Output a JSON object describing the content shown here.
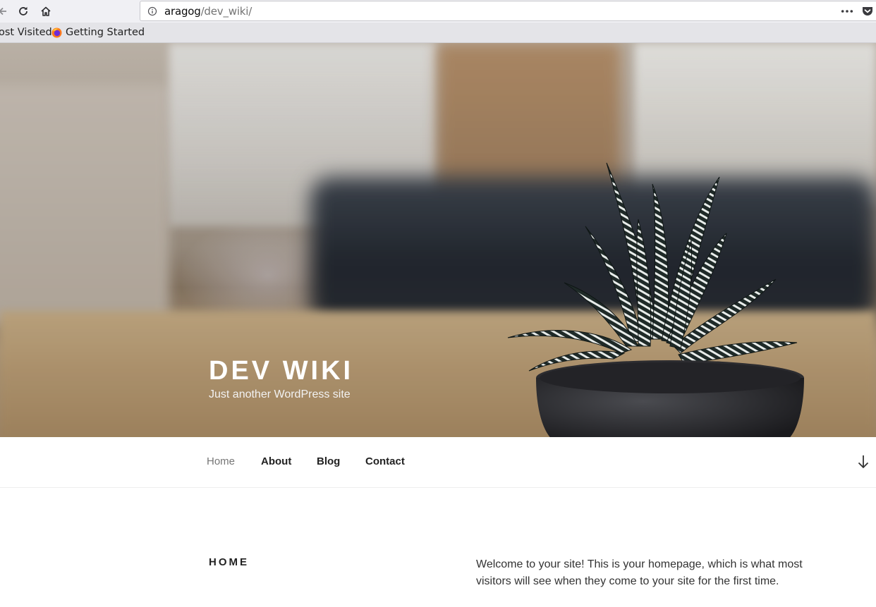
{
  "browser": {
    "url_host": "aragog",
    "url_path": "/dev_wiki/",
    "bookmarks": [
      {
        "label": "ost Visited"
      },
      {
        "label": "Getting Started"
      }
    ]
  },
  "site": {
    "title": "DEV WIKI",
    "tagline": "Just another WordPress site"
  },
  "nav": {
    "items": [
      {
        "label": "Home",
        "current": true
      },
      {
        "label": "About",
        "current": false
      },
      {
        "label": "Blog",
        "current": false
      },
      {
        "label": "Contact",
        "current": false
      }
    ]
  },
  "page": {
    "heading": "HOME",
    "body": "Welcome to your site! This is your homepage, which is what most visitors will see when they come to your site for the first time."
  },
  "icons": {
    "back": "back-arrow-icon",
    "reload": "reload-icon",
    "home": "home-icon",
    "info": "info-icon",
    "more": "page-actions-icon",
    "pocket": "pocket-icon",
    "firefox": "firefox-icon",
    "scroll": "scroll-down-arrow-icon"
  }
}
